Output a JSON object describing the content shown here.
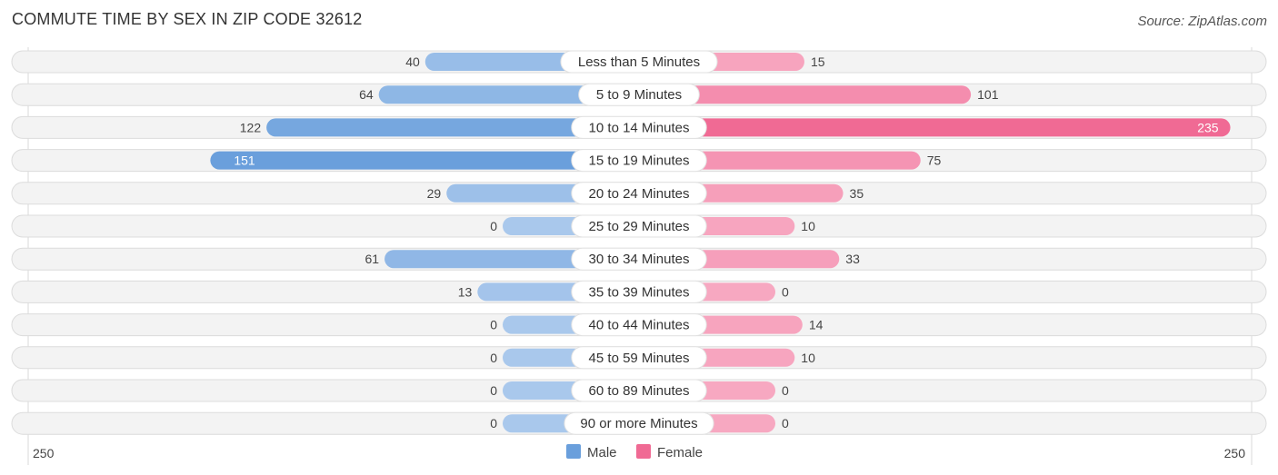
{
  "header": {
    "title": "COMMUTE TIME BY SEX IN ZIP CODE 32612",
    "source": "Source: ZipAtlas.com"
  },
  "chart_data": {
    "type": "bar",
    "orientation": "horizontal-diverging",
    "title": "COMMUTE TIME BY SEX IN ZIP CODE 32612",
    "categories": [
      "Less than 5 Minutes",
      "5 to 9 Minutes",
      "10 to 14 Minutes",
      "15 to 19 Minutes",
      "20 to 24 Minutes",
      "25 to 29 Minutes",
      "30 to 34 Minutes",
      "35 to 39 Minutes",
      "40 to 44 Minutes",
      "45 to 59 Minutes",
      "60 to 89 Minutes",
      "90 or more Minutes"
    ],
    "series": [
      {
        "name": "Male",
        "color": "#6a9fdc",
        "light_color": "#a9c8ec",
        "values": [
          40,
          64,
          122,
          151,
          29,
          0,
          61,
          13,
          0,
          0,
          0,
          0
        ]
      },
      {
        "name": "Female",
        "color": "#f06a94",
        "light_color": "#f7a8c1",
        "values": [
          15,
          101,
          235,
          75,
          35,
          10,
          33,
          0,
          14,
          10,
          0,
          0
        ]
      }
    ],
    "axis": {
      "left_label": "250",
      "right_label": "250",
      "max": 250
    },
    "legend": {
      "position": "bottom-center",
      "items": [
        "Male",
        "Female"
      ]
    }
  }
}
